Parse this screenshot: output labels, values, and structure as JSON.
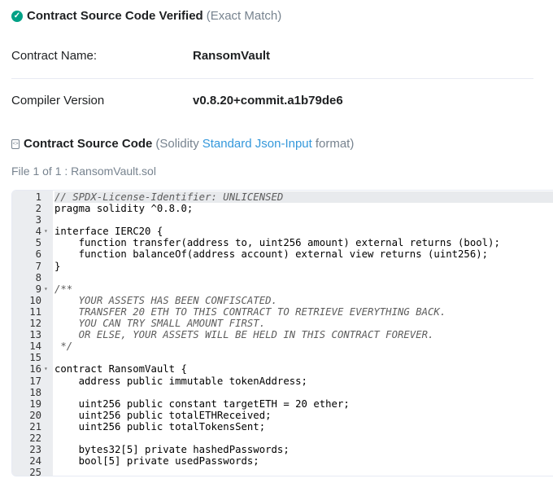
{
  "verified": {
    "title": "Contract Source Code Verified",
    "match": "(Exact Match)"
  },
  "contract_name": {
    "label": "Contract Name:",
    "value": "RansomVault"
  },
  "compiler": {
    "label": "Compiler Version",
    "value": "v0.8.20+commit.a1b79de6"
  },
  "source": {
    "title": "Contract Source Code",
    "pre": "(Solidity",
    "link": "Standard Json-Input",
    "post": "format)"
  },
  "file_label": "File 1 of 1 : RansomVault.sol",
  "code_lines": [
    {
      "n": "1",
      "fold": "",
      "text": "// SPDX-License-Identifier: UNLICENSED",
      "cls": "cm"
    },
    {
      "n": "2",
      "fold": "",
      "text": "pragma solidity ^0.8.0;",
      "cls": ""
    },
    {
      "n": "3",
      "fold": "",
      "text": "",
      "cls": ""
    },
    {
      "n": "4",
      "fold": "▾",
      "text": "interface IERC20 {",
      "cls": ""
    },
    {
      "n": "5",
      "fold": "",
      "text": "    function transfer(address to, uint256 amount) external returns (bool);",
      "cls": ""
    },
    {
      "n": "6",
      "fold": "",
      "text": "    function balanceOf(address account) external view returns (uint256);",
      "cls": ""
    },
    {
      "n": "7",
      "fold": "",
      "text": "}",
      "cls": ""
    },
    {
      "n": "8",
      "fold": "",
      "text": "",
      "cls": ""
    },
    {
      "n": "9",
      "fold": "▾",
      "text": "/**",
      "cls": "cm"
    },
    {
      "n": "10",
      "fold": "",
      "text": "    YOUR ASSETS HAS BEEN CONFISCATED.",
      "cls": "cm"
    },
    {
      "n": "11",
      "fold": "",
      "text": "    TRANSFER 20 ETH TO THIS CONTRACT TO RETRIEVE EVERYTHING BACK.",
      "cls": "cm"
    },
    {
      "n": "12",
      "fold": "",
      "text": "    YOU CAN TRY SMALL AMOUNT FIRST.",
      "cls": "cm"
    },
    {
      "n": "13",
      "fold": "",
      "text": "    OR ELSE, YOUR ASSETS WILL BE HELD IN THIS CONTRACT FOREVER.",
      "cls": "cm"
    },
    {
      "n": "14",
      "fold": "",
      "text": " */",
      "cls": "cm"
    },
    {
      "n": "15",
      "fold": "",
      "text": "",
      "cls": ""
    },
    {
      "n": "16",
      "fold": "▾",
      "text": "contract RansomVault {",
      "cls": ""
    },
    {
      "n": "17",
      "fold": "",
      "text": "    address public immutable tokenAddress;",
      "cls": ""
    },
    {
      "n": "18",
      "fold": "",
      "text": "",
      "cls": ""
    },
    {
      "n": "19",
      "fold": "",
      "text": "    uint256 public constant targetETH = 20 ether;",
      "cls": ""
    },
    {
      "n": "20",
      "fold": "",
      "text": "    uint256 public totalETHReceived;",
      "cls": ""
    },
    {
      "n": "21",
      "fold": "",
      "text": "    uint256 public totalTokensSent;",
      "cls": ""
    },
    {
      "n": "22",
      "fold": "",
      "text": "",
      "cls": ""
    },
    {
      "n": "23",
      "fold": "",
      "text": "    bytes32[5] private hashedPasswords;",
      "cls": ""
    },
    {
      "n": "24",
      "fold": "",
      "text": "    bool[5] private usedPasswords;",
      "cls": ""
    },
    {
      "n": "25",
      "fold": "",
      "text": "",
      "cls": ""
    }
  ],
  "colors": {
    "verified_green": "#00a186",
    "link_blue": "#3498db"
  }
}
